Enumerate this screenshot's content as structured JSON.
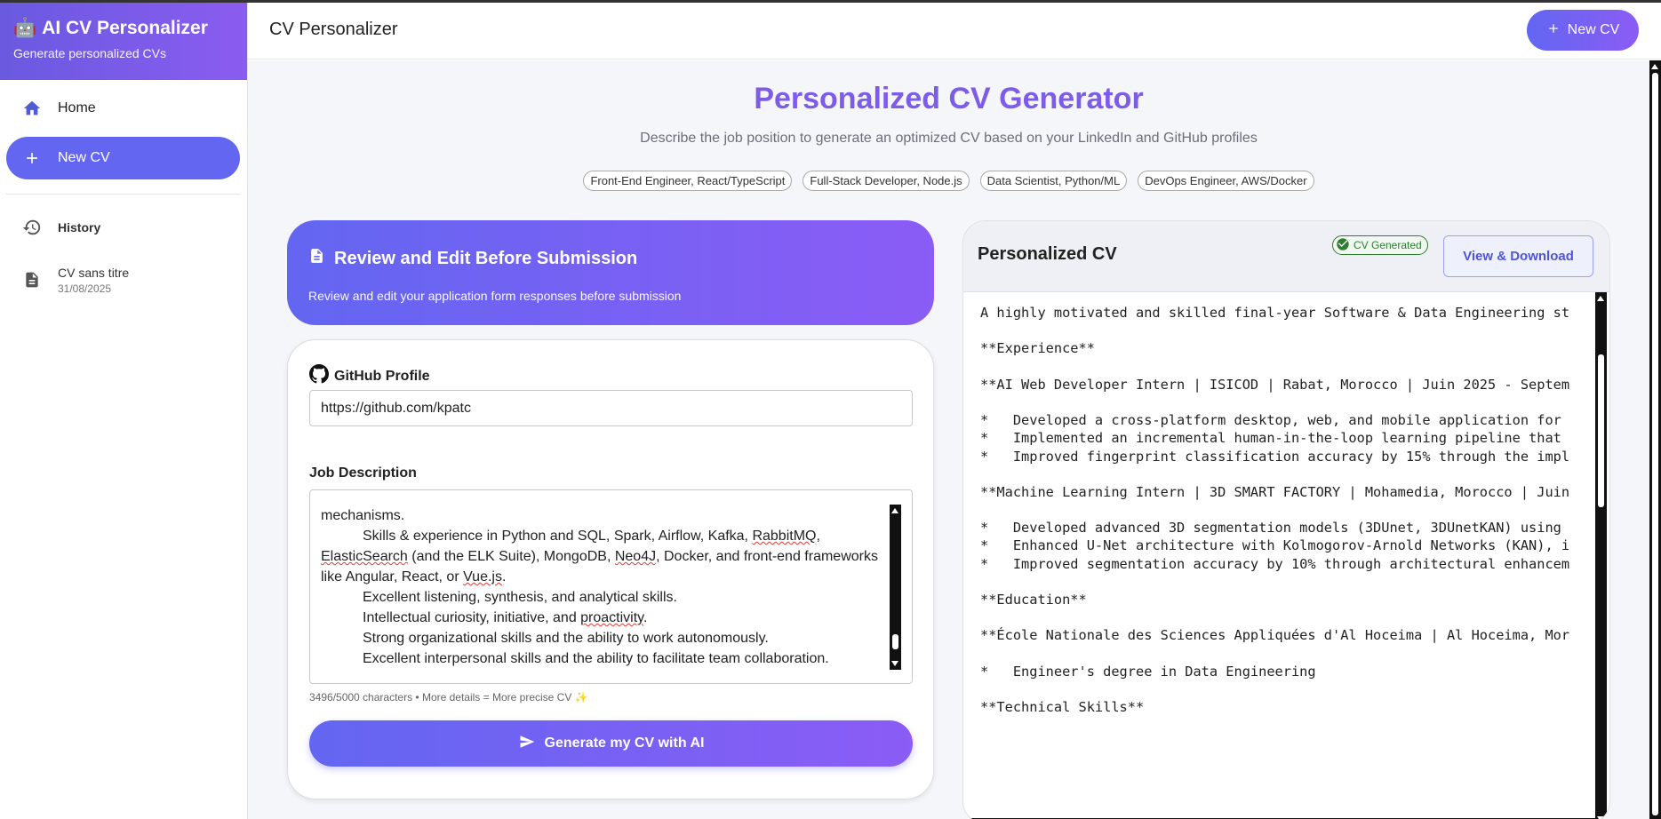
{
  "sidebar": {
    "brand_title": "AI CV Personalizer",
    "brand_emoji": "🤖",
    "brand_subtitle": "Generate personalized CVs",
    "nav": [
      {
        "label": "Home",
        "icon": "home-icon"
      },
      {
        "label": "New CV",
        "icon": "plus-icon",
        "active": true
      }
    ],
    "history_label": "History",
    "history_items": [
      {
        "title": "CV sans titre",
        "date": "31/08/2025",
        "icon": "document-icon"
      }
    ]
  },
  "topbar": {
    "title": "CV Personalizer",
    "new_cv_label": "New CV"
  },
  "hero": {
    "title": "Personalized CV Generator",
    "subtitle": "Describe the job position to generate an optimized CV based on your LinkedIn and GitHub profiles",
    "chips": [
      "Front-End Engineer, React/TypeScript",
      "Full-Stack Developer, Node.js",
      "Data Scientist, Python/ML",
      "DevOps Engineer, AWS/Docker"
    ]
  },
  "review": {
    "title": "Review and Edit Before Submission",
    "subtitle": "Review and edit your application form responses before submission"
  },
  "form": {
    "github_label": "GitHub Profile",
    "github_value": "https://github.com/kpatc",
    "job_label": "Job Description",
    "char_count": "3496/5000 characters • More details = More precise CV ✨",
    "generate_label": "Generate my CV with AI"
  },
  "cv": {
    "title": "Personalized CV",
    "badge": "CV Generated",
    "download_label": "View & Download",
    "lines": [
      "A highly motivated and skilled final-year Software & Data Engineering st",
      "",
      "**Experience**",
      "",
      "**AI Web Developer Intern | ISICOD | Rabat, Morocco | Juin 2025 - Septem",
      "",
      "*   Developed a cross-platform desktop, web, and mobile application for",
      "*   Implemented an incremental human-in-the-loop learning pipeline that",
      "*   Improved fingerprint classification accuracy by 15% through the impl",
      "",
      "**Machine Learning Intern | 3D SMART FACTORY | Mohamedia, Morocco | Juin",
      "",
      "*   Developed advanced 3D segmentation models (3DUnet, 3DUnetKAN) using",
      "*   Enhanced U-Net architecture with Kolmogorov-Arnold Networks (KAN), i",
      "*   Improved segmentation accuracy by 10% through architectural enhancem",
      "",
      "**Education**",
      "",
      "**École Nationale des Sciences Appliquées d'Al Hoceima | Al Hoceima, Mor",
      "",
      "*   Engineer's degree in Data Engineering",
      "",
      "**Technical Skills**"
    ]
  },
  "colors": {
    "accent": "#6366f1",
    "accent_end": "#8b5cf6",
    "hero_title": "#7c5ce8",
    "success": "#2e7d32"
  }
}
